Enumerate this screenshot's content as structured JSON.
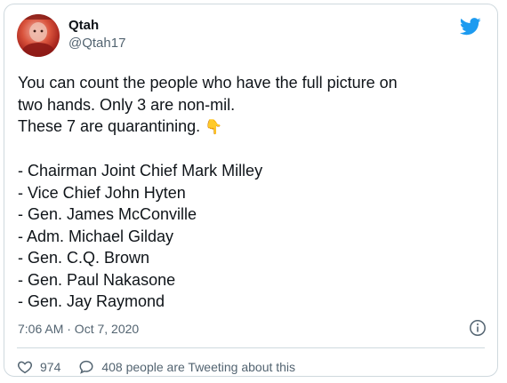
{
  "author": {
    "display_name": "Qtah",
    "handle": "@Qtah17"
  },
  "tweet": {
    "lines": [
      "You can count the people who have the full picture on",
      "two hands. Only 3 are non-mil.",
      "These 7 are quarantining. "
    ],
    "emoji": "👇",
    "list": [
      "- Chairman Joint Chief Mark Milley",
      "- Vice Chief John Hyten",
      "- Gen. James McConville",
      "- Adm. Michael Gilday",
      "- Gen. C.Q. Brown",
      "- Gen. Paul Nakasone",
      "- Gen. Jay Raymond"
    ]
  },
  "meta": {
    "timestamp": "7:06 AM · Oct 7, 2020"
  },
  "actions": {
    "like_count": "974",
    "reply_text": "408 people are Tweeting about this"
  },
  "colors": {
    "twitter_blue": "#1d9bf0",
    "secondary_text": "#536471",
    "border": "#cfd9de"
  },
  "icons": [
    "avatar",
    "twitter-bird-icon",
    "info-icon",
    "heart-icon",
    "speech-bubble-icon"
  ]
}
